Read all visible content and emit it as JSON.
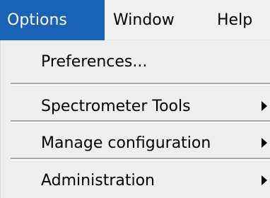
{
  "colors": {
    "menubar_bg": "#f0f0f0",
    "highlight_bg": "#1a62b6",
    "highlight_text": "#ffffff",
    "menu_bg": "#eeeeee",
    "separator_dark": "#a7a7a7",
    "separator_light": "#ffffff"
  },
  "menubar": {
    "items": [
      {
        "label": "Options",
        "active": true
      },
      {
        "label": "Window",
        "active": false
      },
      {
        "label": "Help",
        "active": false
      }
    ]
  },
  "options_menu": {
    "items": [
      {
        "label": "Preferences...",
        "has_submenu": false,
        "icon": ""
      },
      {
        "label": "Spectrometer Tools",
        "has_submenu": true,
        "icon": "submenu-arrow-icon"
      },
      {
        "label": "Manage configuration",
        "has_submenu": true,
        "icon": "submenu-arrow-icon"
      },
      {
        "label": "Administration",
        "has_submenu": true,
        "icon": "submenu-arrow-icon"
      }
    ]
  }
}
